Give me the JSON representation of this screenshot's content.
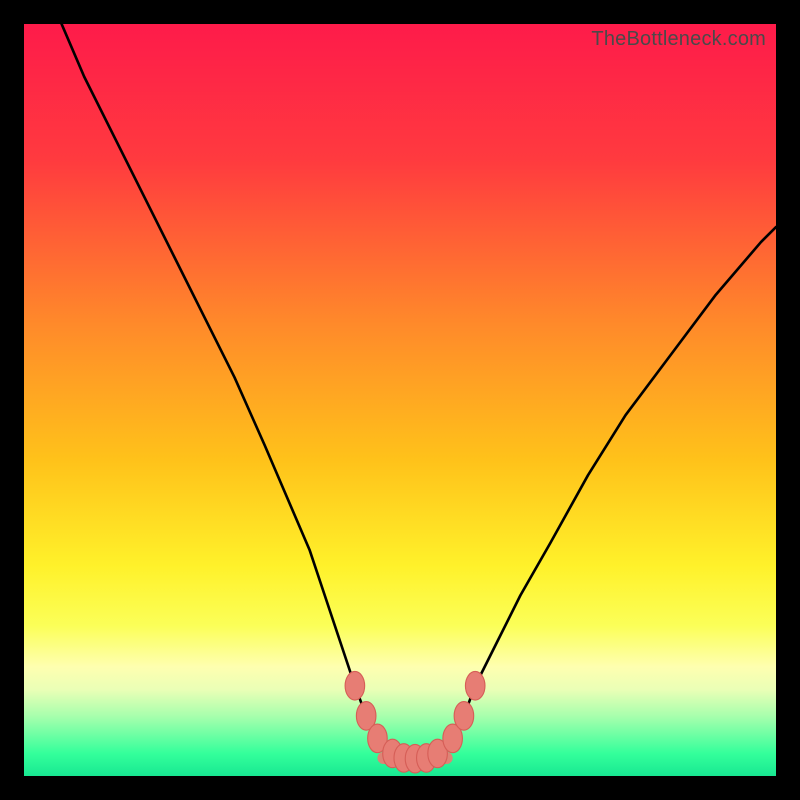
{
  "watermark": "TheBottleneck.com",
  "colors": {
    "frame": "#000000",
    "curve": "#000000",
    "marker_fill": "#e77d74",
    "marker_stroke": "#d65e57",
    "gradient_stops": [
      {
        "offset": 0.0,
        "color": "#fe1b4a"
      },
      {
        "offset": 0.18,
        "color": "#ff3a3f"
      },
      {
        "offset": 0.4,
        "color": "#ff8a2a"
      },
      {
        "offset": 0.58,
        "color": "#ffc21a"
      },
      {
        "offset": 0.72,
        "color": "#fff12a"
      },
      {
        "offset": 0.8,
        "color": "#fbff58"
      },
      {
        "offset": 0.855,
        "color": "#feffb0"
      },
      {
        "offset": 0.885,
        "color": "#eaffb6"
      },
      {
        "offset": 0.92,
        "color": "#a8ffad"
      },
      {
        "offset": 0.97,
        "color": "#34ff9b"
      },
      {
        "offset": 1.0,
        "color": "#18e892"
      }
    ]
  },
  "chart_data": {
    "type": "line",
    "title": "",
    "xlabel": "",
    "ylabel": "",
    "xlim": [
      0,
      100
    ],
    "ylim": [
      0,
      100
    ],
    "grid": false,
    "legend": false,
    "series": [
      {
        "name": "bottleneck-curve",
        "x": [
          5,
          8,
          12,
          16,
          20,
          24,
          28,
          32,
          35,
          38,
          40,
          42,
          44,
          45.5,
          47,
          49,
          51,
          53,
          55,
          57,
          58.5,
          60,
          63,
          66,
          70,
          75,
          80,
          86,
          92,
          98,
          100
        ],
        "values": [
          100,
          93,
          85,
          77,
          69,
          61,
          53,
          44,
          37,
          30,
          24,
          18,
          12,
          8,
          5,
          3,
          2.3,
          2.3,
          3,
          5,
          8,
          12,
          18,
          24,
          31,
          40,
          48,
          56,
          64,
          71,
          73
        ]
      }
    ],
    "markers": [
      {
        "x": 44.0,
        "y": 12.0
      },
      {
        "x": 45.5,
        "y": 8.0
      },
      {
        "x": 47.0,
        "y": 5.0
      },
      {
        "x": 49.0,
        "y": 3.0
      },
      {
        "x": 50.5,
        "y": 2.4
      },
      {
        "x": 52.0,
        "y": 2.3
      },
      {
        "x": 53.5,
        "y": 2.4
      },
      {
        "x": 55.0,
        "y": 3.0
      },
      {
        "x": 57.0,
        "y": 5.0
      },
      {
        "x": 58.5,
        "y": 8.0
      },
      {
        "x": 60.0,
        "y": 12.0
      }
    ],
    "bottom_band": {
      "x": [
        47,
        57
      ],
      "y": 2.4,
      "height": 1.6
    }
  }
}
